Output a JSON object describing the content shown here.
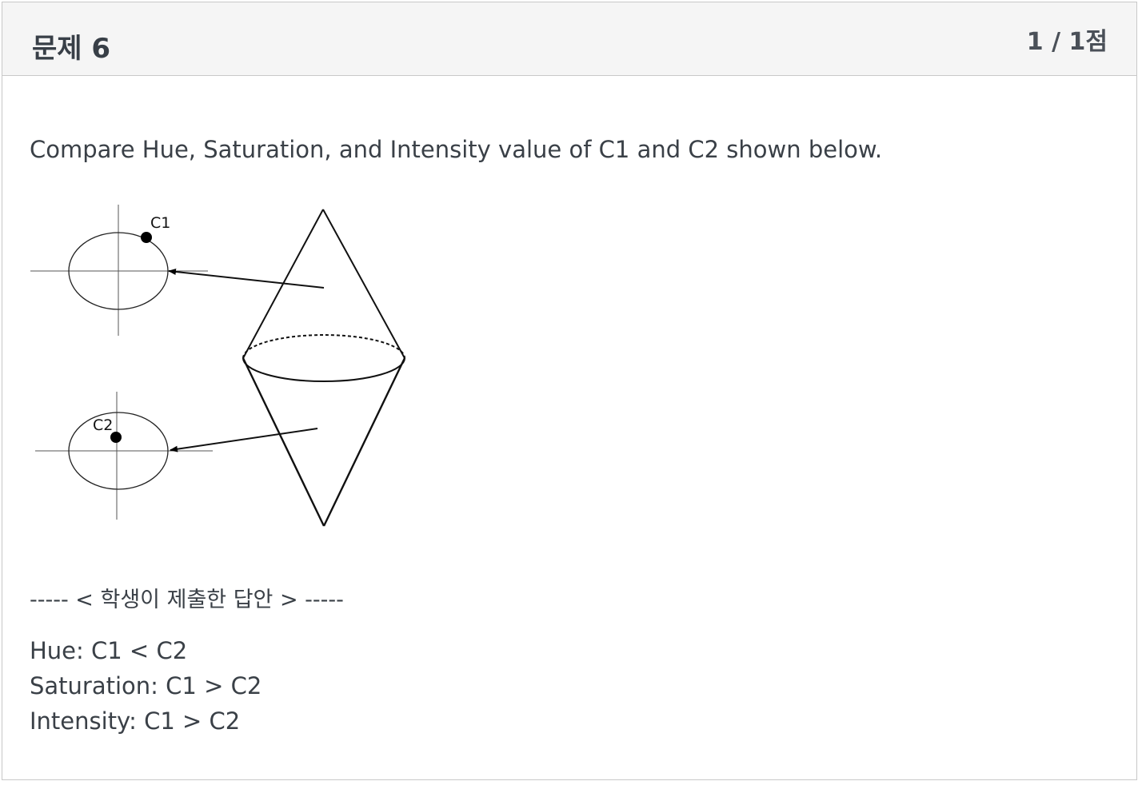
{
  "header": {
    "title": "문제 6",
    "score": "1 / 1점"
  },
  "question": {
    "prompt": "Compare Hue, Saturation, and Intensity value of C1 and C2 shown below.",
    "figure": {
      "point_labels": [
        "C1",
        "C2"
      ]
    }
  },
  "submission": {
    "separator": "----- < 학생이 제출한 답안 > -----",
    "lines": [
      "Hue: C1 < C2",
      "Saturation: C1 > C2",
      "Intensity: C1 > C2"
    ]
  }
}
